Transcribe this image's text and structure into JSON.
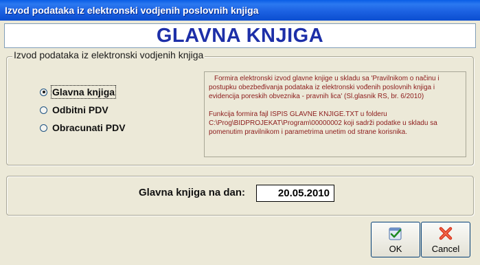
{
  "window": {
    "title": "Izvod podataka iz elektronski vodjenih  poslovnih knjiga"
  },
  "heading": "GLAVNA KNJIGA",
  "options_group": {
    "legend": "Izvod podataka iz elektronski vodjenih knjiga",
    "selected": "Glavna knjiga",
    "items": [
      {
        "label": "Glavna knjiga",
        "checked": true
      },
      {
        "label": "Odbitni PDV",
        "checked": false
      },
      {
        "label": "Obracunati PDV",
        "checked": false
      }
    ]
  },
  "description": {
    "paragraph1": "Formira elektronski izvod glavne knjige u skladu sa 'Pravilnikom o načinu i postupku obezbeđivanja podataka iz elektronski vođenih poslovnih knjiga i evidencija poreskih obveznika - pravnih lica' (Sl.glasnik RS, br. 6/2010)",
    "paragraph2": "Funkcija formira fajl ISPIS GLAVNE KNJIGE.TXT u folderu C:\\Prog\\BIDPROJEKAT\\Program\\00000002 koji sadrži podatke u skladu sa pomenutim pravilnikom i parametrima unetim od strane korisnika."
  },
  "date_panel": {
    "label": "Glavna knjiga na dan:",
    "value": "20.05.2010"
  },
  "buttons": {
    "ok_label": "OK",
    "cancel_label": "Cancel"
  },
  "icons": {
    "ok": "checkmark-icon",
    "cancel": "x-icon"
  },
  "colors": {
    "titlebar": "#0a5ee6",
    "heading_text": "#1d2fa8",
    "description_text": "#8b1a1a",
    "window_bg": "#ece9d8"
  }
}
